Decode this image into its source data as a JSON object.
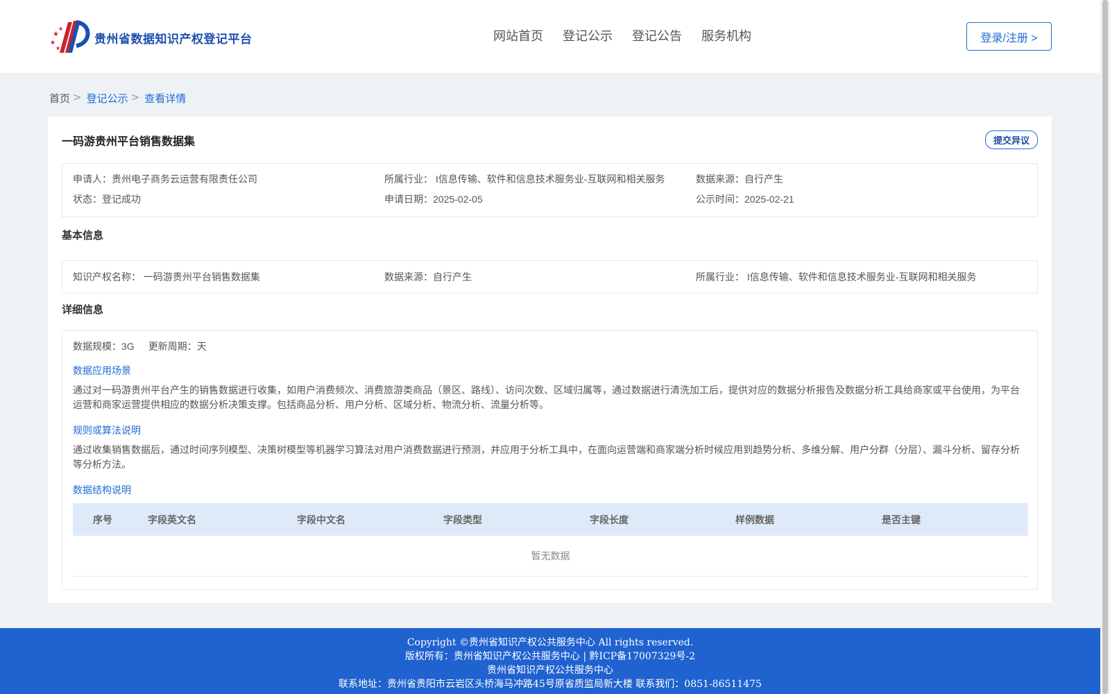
{
  "header": {
    "site_title": "贵州省数据知识产权登记平台",
    "nav": [
      "网站首页",
      "登记公示",
      "登记公告",
      "服务机构"
    ],
    "login_label": "登录/注册 >"
  },
  "breadcrumb": {
    "home": "首页",
    "list": "登记公示",
    "current": "查看详情",
    "sep": ">"
  },
  "record": {
    "title": "一码游贵州平台销售数据集",
    "objection_label": "提交异议",
    "summary": {
      "applicant_label": "申请人：",
      "applicant": "贵州电子商务云运营有限责任公司",
      "industry_label": "所属行业：",
      "industry": "I信息传输、软件和信息技术服务业-互联网和相关服务",
      "source_label": "数据来源：",
      "source": "自行产生",
      "status_label": "状态：",
      "status": "登记成功",
      "apply_date_label": "申请日期：",
      "apply_date": "2025-02-05",
      "publish_date_label": "公示时间：",
      "publish_date": "2025-02-21"
    },
    "basic": {
      "section_title": "基本信息",
      "ip_name_label": "知识产权名称：",
      "ip_name": "一码游贵州平台销售数据集",
      "source_label": "数据来源：",
      "source": "自行产生",
      "industry_label": "所属行业：",
      "industry": "I信息传输、软件和信息技术服务业-互联网和相关服务"
    },
    "detail": {
      "section_title": "详细信息",
      "scale_label": "数据规模：",
      "scale": "3G",
      "cycle_label": "更新周期：",
      "cycle": "天",
      "scenario_title": "数据应用场景",
      "scenario_text": "通过对一码游贵州平台产生的销售数据进行收集，如用户消费频次、消费旅游类商品（景区、路线）、访问次数、区域归属等，通过数据进行清洗加工后，提供对应的数据分析报告及数据分析工具给商家或平台使用，为平台运营和商家运营提供相应的数据分析决策支撑。包括商品分析、用户分析、区域分析、物流分析、流量分析等。",
      "algorithm_title": "规则或算法说明",
      "algorithm_text": "通过收集销售数据后，通过时间序列模型、决策树模型等机器学习算法对用户消费数据进行预测，并应用于分析工具中，在面向运营端和商家端分析时候应用到趋势分析、多维分解、用户分群（分层）、漏斗分析、留存分析等分析方法。",
      "structure_title": "数据结构说明",
      "table_headers": [
        "序号",
        "字段英文名",
        "字段中文名",
        "字段类型",
        "字段长度",
        "样例数据",
        "是否主键"
      ],
      "empty_text": "暂无数据"
    }
  },
  "footer": {
    "copyright": "Copyright ©贵州省知识产权公共服务中心 All rights reserved.",
    "owner": "版权所有：贵州省知识产权公共服务中心 | 黔ICP备17007329号-2",
    "org": "贵州省知识产权公共服务中心",
    "contact": "联系地址：贵州省贵阳市云岩区头桥海马冲路45号原省质监局新大楼 联系我们：0851-86511475"
  }
}
